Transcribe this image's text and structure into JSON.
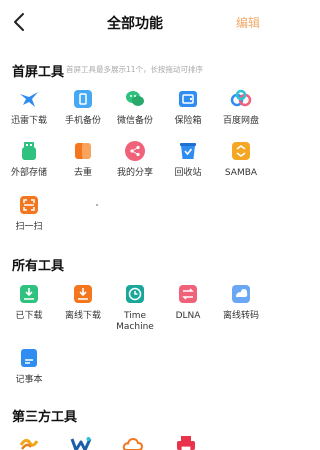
{
  "header": {
    "title": "全部功能",
    "edit_label": "编辑"
  },
  "home_tools": {
    "title": "首屏工具",
    "hint": "首屏工具最多展示11个，长按拖动可排序",
    "items": [
      {
        "label": "迅雷下载",
        "icon": "thunder-bird-icon"
      },
      {
        "label": "手机备份",
        "icon": "phone-backup-icon"
      },
      {
        "label": "微信备份",
        "icon": "wechat-backup-icon"
      },
      {
        "label": "保险箱",
        "icon": "safe-box-icon"
      },
      {
        "label": "百度网盘",
        "icon": "baidu-pan-icon"
      },
      {
        "label": "外部存储",
        "icon": "external-storage-icon"
      },
      {
        "label": "去重",
        "icon": "dedupe-icon"
      },
      {
        "label": "我的分享",
        "icon": "share-icon"
      },
      {
        "label": "回收站",
        "icon": "recycle-bin-icon"
      },
      {
        "label": "SAMBA",
        "icon": "samba-icon"
      },
      {
        "label": "扫一扫",
        "icon": "scan-icon"
      }
    ]
  },
  "all_tools": {
    "title": "所有工具",
    "items": [
      {
        "label": "已下载",
        "icon": "downloaded-icon"
      },
      {
        "label": "离线下载",
        "icon": "offline-download-icon"
      },
      {
        "label": "Time Machine",
        "icon": "time-machine-icon"
      },
      {
        "label": "DLNA",
        "icon": "dlna-icon"
      },
      {
        "label": "离线转码",
        "icon": "offline-transcode-icon"
      },
      {
        "label": "记事本",
        "icon": "notepad-icon"
      }
    ]
  },
  "third_party": {
    "title": "第三方工具",
    "items": [
      {
        "icon": "third-party-logo-1-icon"
      },
      {
        "icon": "third-party-logo-w-icon"
      },
      {
        "icon": "third-party-cloud-icon"
      },
      {
        "icon": "third-party-printer-icon"
      }
    ]
  },
  "colors": {
    "accent_orange": "#f0a96a",
    "blue": "#2f8cf0",
    "green": "#2ec27e",
    "teal": "#1aa79a",
    "orange": "#f4761e",
    "pink": "#f0617a"
  }
}
